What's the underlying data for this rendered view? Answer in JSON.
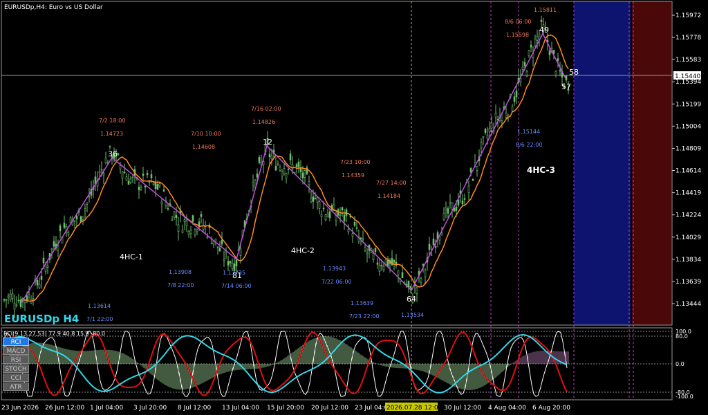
{
  "header": {
    "symbol_title": "EURUSDp,H4:  Euro vs US Dollar"
  },
  "watermark": "EURUSDp H4",
  "indicator_header": "RCI(9,13,27,53) 77.9 40.8 15.9 -80.0",
  "indicator_buttons": [
    {
      "label": "RCI",
      "active": true
    },
    {
      "label": "MACD",
      "active": false
    },
    {
      "label": "RSI",
      "active": false
    },
    {
      "label": "STOCH",
      "active": false
    },
    {
      "label": "CCI",
      "active": false
    },
    {
      "label": "ATR",
      "active": false
    }
  ],
  "price_axis": [
    "1.15972",
    "1.15778",
    "1.15583",
    "1.15394",
    "1.15199",
    "1.15004",
    "1.14809",
    "1.14614",
    "1.14419",
    "1.14224",
    "1.14029",
    "1.13834",
    "1.13639",
    "1.13444"
  ],
  "current_price": "1.15440",
  "sub_axis": [
    "100.0",
    "80.0",
    "0.0",
    "-80.0",
    "-100.0"
  ],
  "time_axis": [
    "23 Jun 2026",
    "26 Jun 12:00",
    "1 Jul 04:00",
    "3 Jul 20:00",
    "8 Jul 12:00",
    "13 Jul 04:00",
    "15 Jul 20:00",
    "20 Jul 12:00",
    "23 Jul 04:00",
    "2026.07.28 12:00",
    "30 Jul 12:00",
    "4 Aug 04:00",
    "6 Aug 20:00"
  ],
  "zigzag_labels": [
    {
      "text": "36",
      "kind": "point"
    },
    {
      "text": "81",
      "kind": "point"
    },
    {
      "text": "12",
      "kind": "point"
    },
    {
      "text": "64",
      "kind": "point"
    },
    {
      "text": "49",
      "kind": "point"
    },
    {
      "text": "57",
      "kind": "point"
    },
    {
      "text": "58",
      "kind": "point"
    },
    {
      "text": "4HC-1",
      "kind": "wave"
    },
    {
      "text": "4HC-2",
      "kind": "wave"
    },
    {
      "text": "4HC-3",
      "kind": "wave"
    }
  ],
  "price_notes": [
    {
      "time": "7/2 18:00",
      "price": "1.14723",
      "color": "#f07a5a"
    },
    {
      "time": "7/10 10:00",
      "price": "1.14608",
      "color": "#f07a5a"
    },
    {
      "time": "7/16 02:00",
      "price": "1.14826",
      "color": "#f07a5a"
    },
    {
      "time": "7/23 10:00",
      "price": "1.14359",
      "color": "#f07a5a"
    },
    {
      "time": "7/27 14:00",
      "price": "1.14184",
      "color": "#f07a5a"
    },
    {
      "time": "8/6 06:00",
      "price": "1.15598",
      "color": "#f07a5a"
    },
    {
      "time": "",
      "price": "1.15811",
      "color": "#f07a5a"
    },
    {
      "time": "7/1 22:00",
      "price": "1.13614",
      "color": "#6a8cff"
    },
    {
      "time": "7/8 22:00",
      "price": "1.13908",
      "color": "#6a8cff"
    },
    {
      "time": "7/14 06:00",
      "price": "1.13735",
      "color": "#6a8cff"
    },
    {
      "time": "7/22 06:00",
      "price": "1.13943",
      "color": "#6a8cff"
    },
    {
      "time": "7/23 22:00",
      "price": "1.13639",
      "color": "#6a8cff"
    },
    {
      "time": "",
      "price": "1.13534",
      "color": "#6a8cff"
    },
    {
      "time": "8/6 22:00",
      "price": "1.15144",
      "color": "#6a8cff"
    }
  ],
  "colors": {
    "bg": "#000000",
    "candle": "#6fbf6f",
    "ma": "#ff8c1a",
    "zigzag": "#c050e0",
    "grid": "#c040c0",
    "cyan": "#33d6ea",
    "red": "#e01010",
    "white": "#ffffff",
    "histogram": "#a8e0a0",
    "future_blue": "#0c1470",
    "future_red": "#4a0808"
  }
}
